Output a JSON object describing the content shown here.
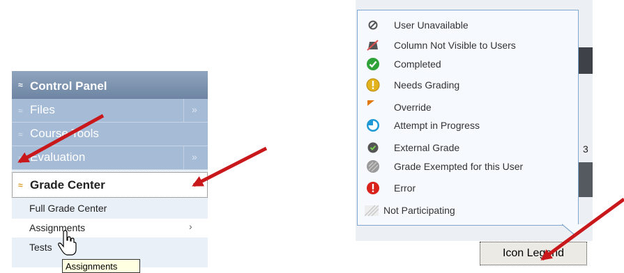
{
  "control_panel": {
    "title": "Control Panel",
    "header_chevron": "≈",
    "items": [
      {
        "label": "Files",
        "more": "»"
      },
      {
        "label": "Course Tools",
        "more": ""
      },
      {
        "label": "Evaluation",
        "more": "»"
      }
    ],
    "active_item": {
      "label": "Grade Center",
      "chevron": "≈"
    },
    "sub_items": [
      {
        "label": "Full Grade Center",
        "arrow": ""
      },
      {
        "label": "Assignments",
        "arrow": "›"
      },
      {
        "label": "Tests",
        "arrow": ""
      }
    ],
    "tooltip": "Assignments"
  },
  "legend": {
    "items": [
      {
        "icon": "user-unavailable-icon",
        "label": "User Unavailable"
      },
      {
        "icon": "column-not-visible-icon",
        "label": "Column Not Visible to Users"
      },
      {
        "icon": "completed-icon",
        "label": "Completed"
      },
      {
        "icon": "needs-grading-icon",
        "label": "Needs Grading"
      },
      {
        "icon": "override-icon",
        "label": "Override"
      },
      {
        "icon": "attempt-in-progress-icon",
        "label": "Attempt in Progress"
      },
      {
        "icon": "external-grade-icon",
        "label": "External Grade"
      },
      {
        "icon": "grade-exempted-icon",
        "label": "Grade Exempted for this User"
      },
      {
        "icon": "error-icon",
        "label": "Error"
      },
      {
        "icon": "not-participating-icon",
        "label": "Not Participating"
      }
    ]
  },
  "background": {
    "visible_digit": "3"
  },
  "icon_legend_button": "Icon Legend",
  "colors": {
    "panel_header": "#7890ad",
    "panel_row": "#a6bbd6",
    "arrow_red": "#c8181b",
    "legend_border": "#7ea6cf"
  }
}
